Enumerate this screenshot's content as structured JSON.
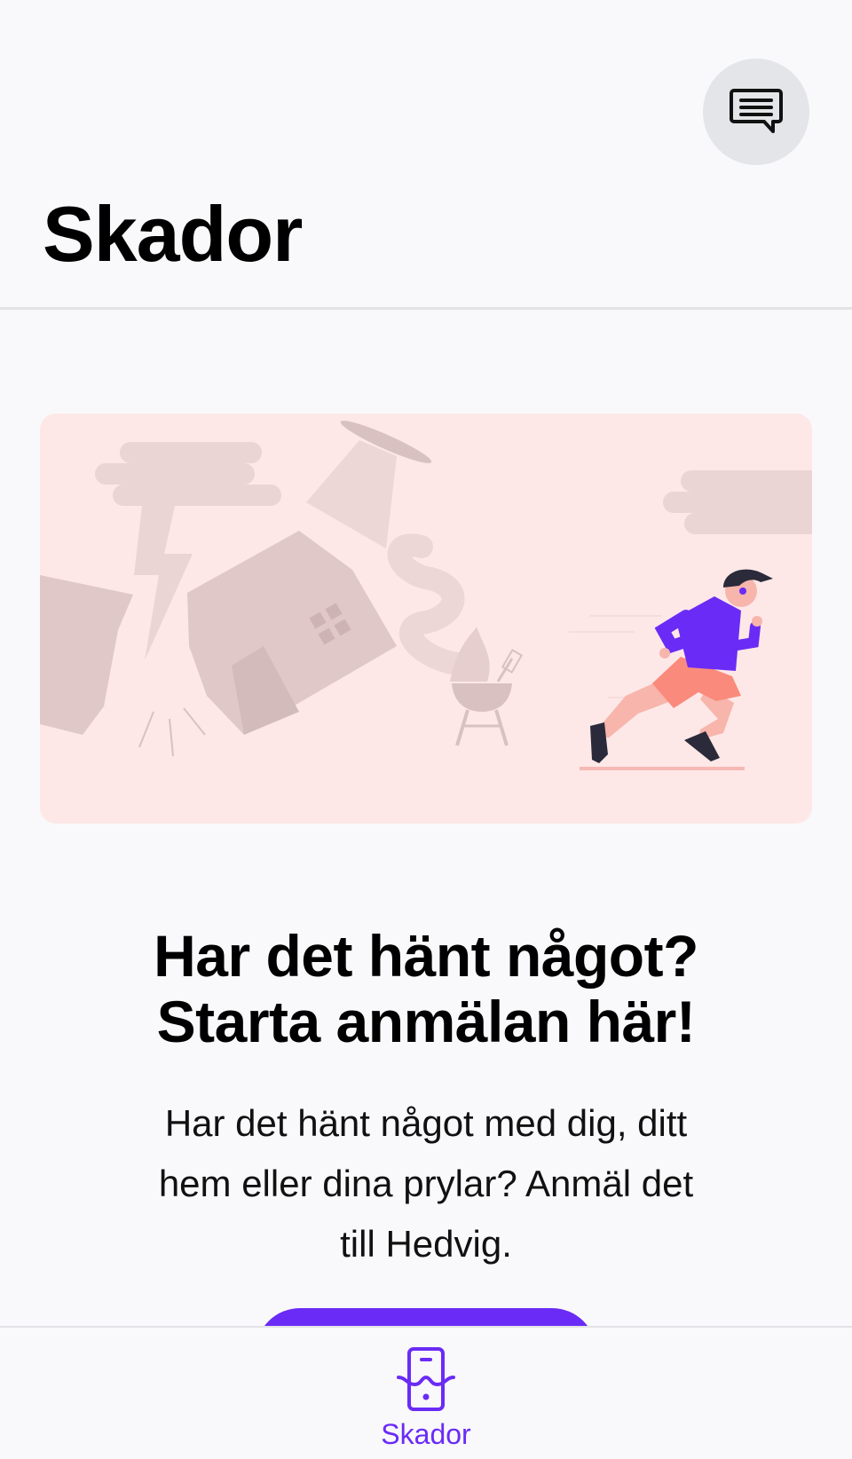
{
  "header": {
    "title": "Skador",
    "chat_icon": "chat-bubble-icon"
  },
  "illustration": {
    "description_icon": "claims-illustration",
    "background_color": "#fde8e7"
  },
  "content": {
    "headline_line1": "Har det hänt något?",
    "headline_line2": "Starta anmälan här!",
    "body_line1": "Har det hänt något med dig, ditt",
    "body_line2": "hem eller dina prylar? Anmäl det",
    "body_line3": "till Hedvig."
  },
  "cta": {
    "color": "#6a2bf6"
  },
  "tab_bar": {
    "items": [
      {
        "label": "Skador",
        "icon": "claims-tab-icon",
        "active": true
      }
    ]
  },
  "colors": {
    "accent": "#6a2bf6",
    "background": "#f9f9fb"
  }
}
